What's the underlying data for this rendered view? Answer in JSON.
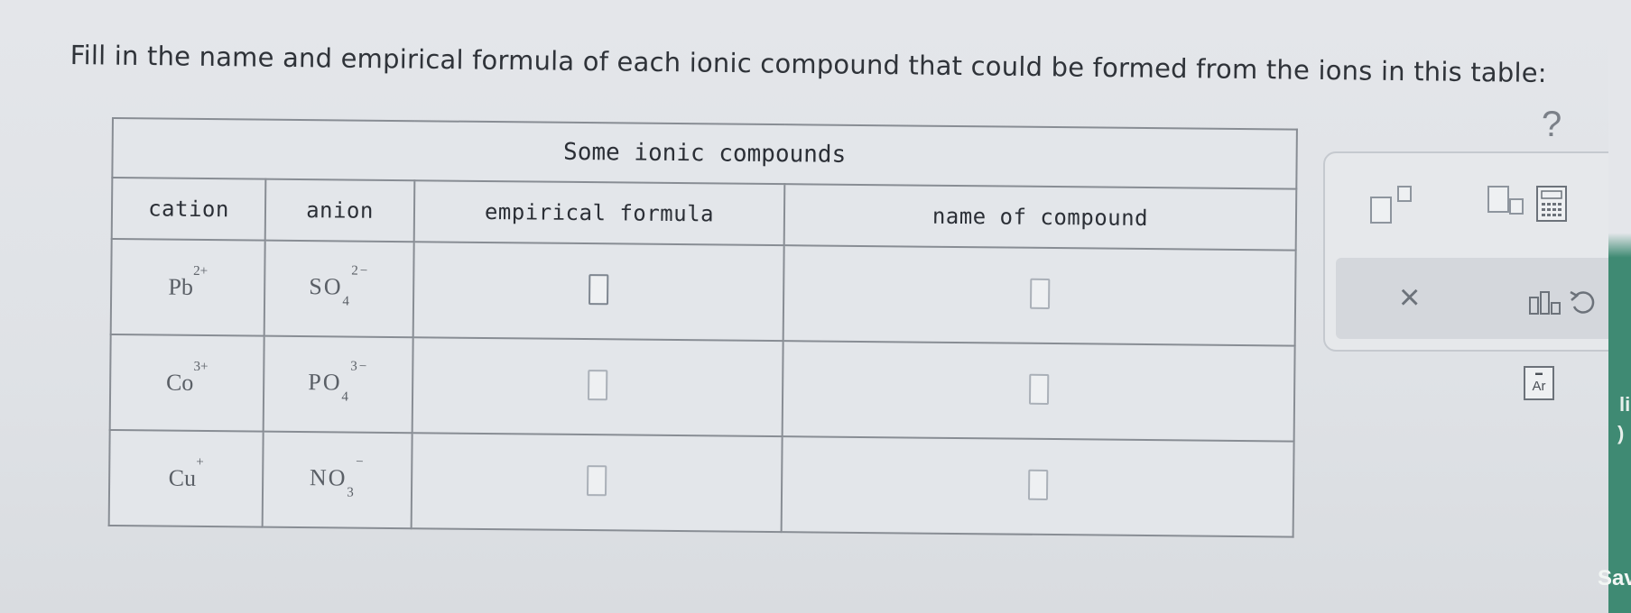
{
  "prompt": "Fill in the name and empirical formula of each ionic compound that could be formed from the ions in this table:",
  "help_symbol": "?",
  "table": {
    "caption": "Some ionic compounds",
    "headers": [
      "cation",
      "anion",
      "empirical formula",
      "name of compound"
    ],
    "rows": [
      {
        "cation": {
          "symbol": "Pb",
          "charge": "2+"
        },
        "anion": {
          "symbol": "SO",
          "sub": "4",
          "charge": "2−"
        }
      },
      {
        "cation": {
          "symbol": "Co",
          "charge": "3+"
        },
        "anion": {
          "symbol": "PO",
          "sub": "4",
          "charge": "3−"
        }
      },
      {
        "cation": {
          "symbol": "Cu",
          "charge": "+"
        },
        "anion": {
          "symbol": "NO",
          "sub": "3",
          "charge": "−"
        }
      }
    ]
  },
  "tools": {
    "close_symbol": "×",
    "ar_top": "▬",
    "ar_label": "Ar"
  },
  "side": {
    "text_top": "li",
    "text_mid": ")",
    "text_bottom": "Sav"
  },
  "icons": [
    "superscript-icon",
    "subscript-icon",
    "keypad-icon",
    "close-icon",
    "chart-icon",
    "undo-icon",
    "periodic-table-icon",
    "help-icon"
  ]
}
